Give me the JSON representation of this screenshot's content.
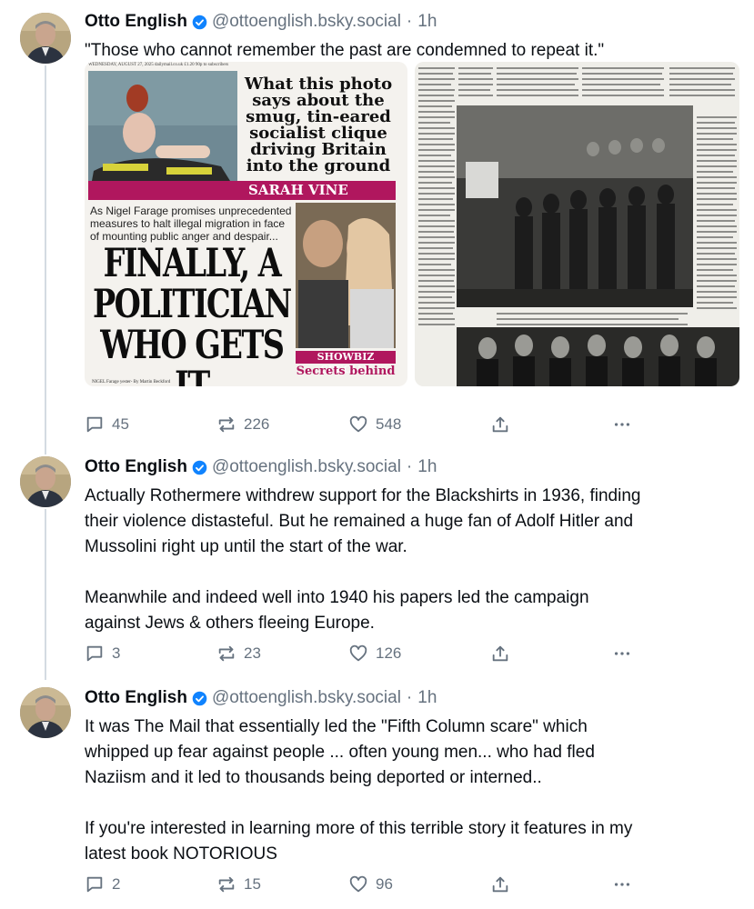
{
  "posts": [
    {
      "author": "Otto English",
      "handle": "@ottoenglish.bsky.social",
      "time": "1h",
      "text": [
        "\"Those who cannot remember the past are condemned to repeat it.\""
      ],
      "media": {
        "newspaper": {
          "masthead": "WEDNESDAY, AUGUST 27, 2025    dailymail.co.uk    £1.20  90p to subscribers",
          "headline": "What this photo says about the smug, tin-eared socialist clique driving Britain into the ground",
          "byline": "SARAH VINE",
          "subhead": "As Nigel Farage promises unprecedented measures to halt illegal migration in face of mounting public anger and despair...",
          "main_headline": "FINALLY, A POLITICIAN WHO GETS IT",
          "showbiz": "SHOWBIZ SPECIAL",
          "secrets": "Secrets behind",
          "footer": "NIGEL Farage yester-   By Martin Beckford"
        }
      },
      "stats": {
        "replies": "45",
        "reposts": "226",
        "likes": "548"
      }
    },
    {
      "author": "Otto English",
      "handle": "@ottoenglish.bsky.social",
      "time": "1h",
      "text": [
        "Actually Rothermere withdrew support for the Blackshirts in 1936, finding",
        "their violence distasteful. But he remained a huge fan of Adolf Hitler and",
        "Mussolini right up until the start of the war.",
        "",
        "Meanwhile and indeed well into 1940 his papers led the campaign",
        "against Jews & others fleeing Europe."
      ],
      "stats": {
        "replies": "3",
        "reposts": "23",
        "likes": "126"
      }
    },
    {
      "author": "Otto English",
      "handle": "@ottoenglish.bsky.social",
      "time": "1h",
      "text": [
        "It was The Mail that essentially led the \"Fifth Column scare\" which",
        "whipped up fear against people ... often young men... who had fled",
        "Naziism and it led to thousands being deported or interned..",
        "",
        "If you're interested in learning more of this terrible story it features in my",
        "latest book NOTORIOUS"
      ],
      "stats": {
        "replies": "2",
        "reposts": "15",
        "likes": "96"
      }
    }
  ],
  "colors": {
    "accent": "#1083fe",
    "muted": "#66727f",
    "thread_line": "#d4dbe2",
    "mail_pink": "#b0175e"
  },
  "icons": {
    "reply": "speech-bubble-icon",
    "repost": "repost-icon",
    "like": "heart-icon",
    "share": "share-icon",
    "more": "more-dots-icon",
    "verified": "verified-check-icon"
  }
}
